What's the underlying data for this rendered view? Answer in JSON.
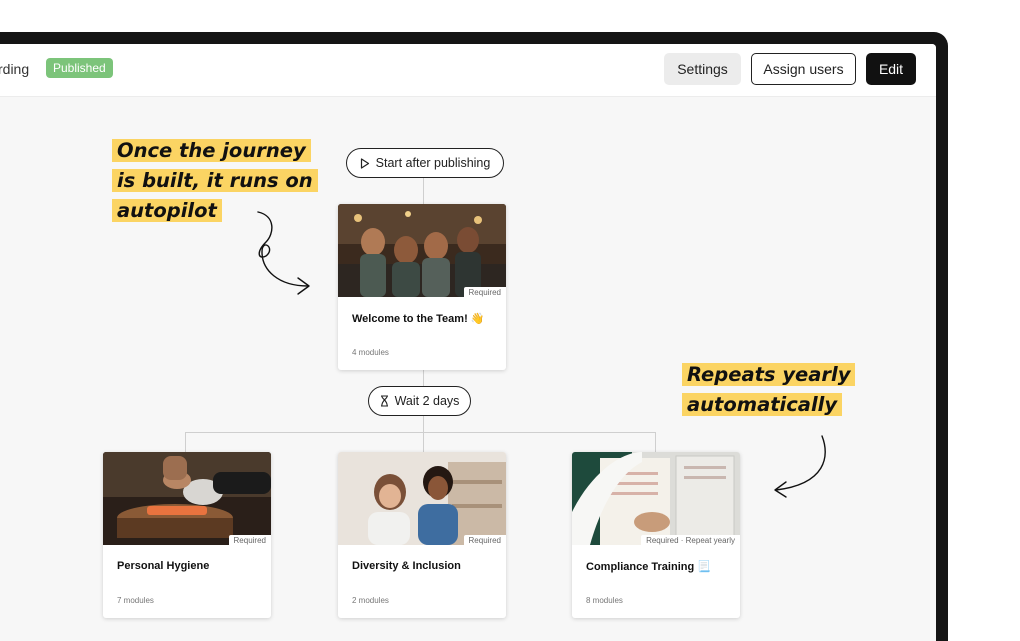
{
  "header": {
    "journey_name": "rding",
    "status": "Published",
    "settings_label": "Settings",
    "assign_label": "Assign users",
    "edit_label": "Edit"
  },
  "flow": {
    "start_label": "Start after publishing",
    "wait_label": "Wait 2 days"
  },
  "cards": {
    "welcome": {
      "tag": "Required",
      "title": "Welcome to the Team! 👋",
      "meta": "4 modules"
    },
    "hygiene": {
      "tag": "Required",
      "title": "Personal Hygiene",
      "meta": "7 modules"
    },
    "diversity": {
      "tag": "Required",
      "title": "Diversity & Inclusion",
      "meta": "2 modules"
    },
    "compliance": {
      "tag": "Required · Repeat yearly",
      "title": "Compliance Training 📃",
      "meta": "8 modules"
    }
  },
  "callouts": {
    "autopilot_lines": [
      "Once the journey",
      "is built, it runs on",
      "autopilot"
    ],
    "repeat_lines": [
      "Repeats yearly",
      "automatically"
    ]
  },
  "colors": {
    "highlight": "#fbd463",
    "published": "#7cc47a",
    "frame": "#151515"
  },
  "icons": {
    "start": "play-icon",
    "wait": "hourglass-icon"
  }
}
